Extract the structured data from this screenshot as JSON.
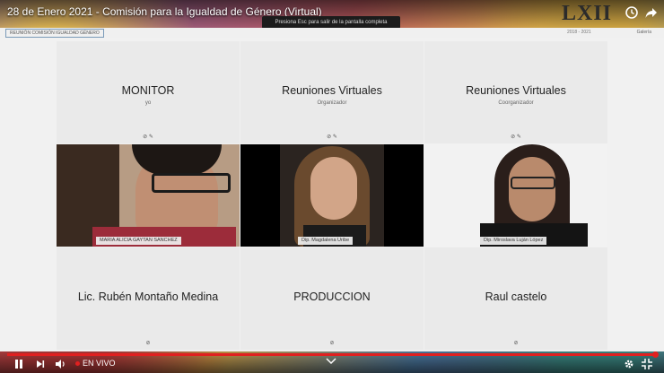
{
  "video": {
    "title": "28 de Enero 2021 - Comisión para la Igualdad de Género (Virtual)",
    "logo": "LXII",
    "live_label": "EN VIVO",
    "toast": "Presiona Esc para salir de la pantalla completa"
  },
  "meeting": {
    "name_tag": "REUNIÓN COMISIÓN IGUALDAD GÉNERO",
    "strip_mid": "2018 - 2021",
    "view_label": "Galería"
  },
  "tiles": [
    {
      "name": "MONITOR",
      "role": "yo",
      "type": "placeholder",
      "icons": "⊘ ✎"
    },
    {
      "name": "Reuniones Virtuales",
      "role": "Organizador",
      "type": "placeholder",
      "icons": "⊘ ✎"
    },
    {
      "name": "Reuniones Virtuales",
      "role": "Coorganizador",
      "type": "placeholder",
      "icons": "⊘ ✎"
    },
    {
      "name": "MARIA ALICIA GAYTAN SANCHEZ",
      "type": "video"
    },
    {
      "name": "Dip. Magdalena Uribe",
      "type": "video"
    },
    {
      "name": "Dip. Miroslava Luján López",
      "type": "video"
    },
    {
      "name": "Lic. Rubén Montaño Medina",
      "role": "",
      "type": "placeholder",
      "icons": "⊘"
    },
    {
      "name": "PRODUCCION",
      "role": "",
      "type": "placeholder",
      "icons": "⊘"
    },
    {
      "name": "Raul castelo",
      "role": "",
      "type": "placeholder",
      "icons": "⊘"
    }
  ],
  "colors": {
    "accent": "#2ea2e6",
    "live": "#e02020"
  },
  "progress": 1.0
}
